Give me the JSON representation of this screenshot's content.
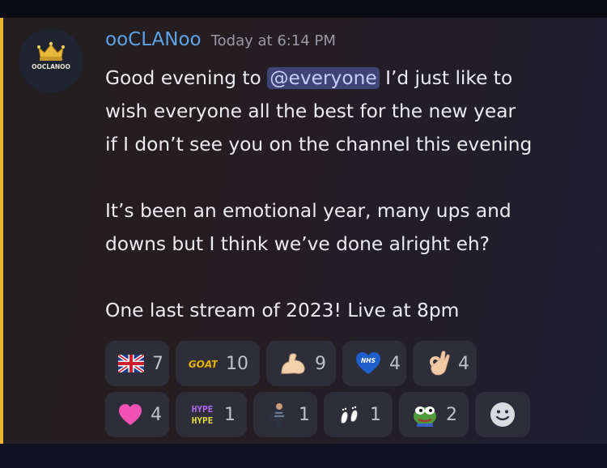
{
  "message": {
    "author": "ooCLANoo",
    "timestamp": "Today at 6:14 PM",
    "avatar_text": "OOCLANOO",
    "line1_before": "Good evening to ",
    "mention": "@everyone",
    "line1_after": " I’d just like to",
    "line2": "wish everyone all the best for the new year",
    "line3": "if I don’t see you on the channel this evening",
    "line4": "It’s been an emotional year, many ups and",
    "line5": "downs but I think we’ve done alright eh?",
    "line6": "One last stream of 2023! Live at 8pm"
  },
  "reactions": [
    {
      "emoji": "uk-flag",
      "count": "7"
    },
    {
      "emoji": "goat",
      "count": "10"
    },
    {
      "emoji": "flexed-biceps",
      "count": "9"
    },
    {
      "emoji": "nhs-heart",
      "count": "4"
    },
    {
      "emoji": "ok-hand",
      "count": "4"
    },
    {
      "emoji": "pink-heart",
      "count": "4"
    },
    {
      "emoji": "hype",
      "count": "1"
    },
    {
      "emoji": "person-sticker",
      "count": "1"
    },
    {
      "emoji": "feet",
      "count": "1"
    },
    {
      "emoji": "pepe",
      "count": "2"
    }
  ],
  "emoji_text": {
    "goat": "GOAT",
    "nhs": "NHS",
    "hype": "HYPE"
  },
  "colors": {
    "accent_bar": "#f0b232",
    "username": "#5ea3e8",
    "mention_bg": "#3e4477",
    "reaction_bg": "#2e2e3b"
  }
}
